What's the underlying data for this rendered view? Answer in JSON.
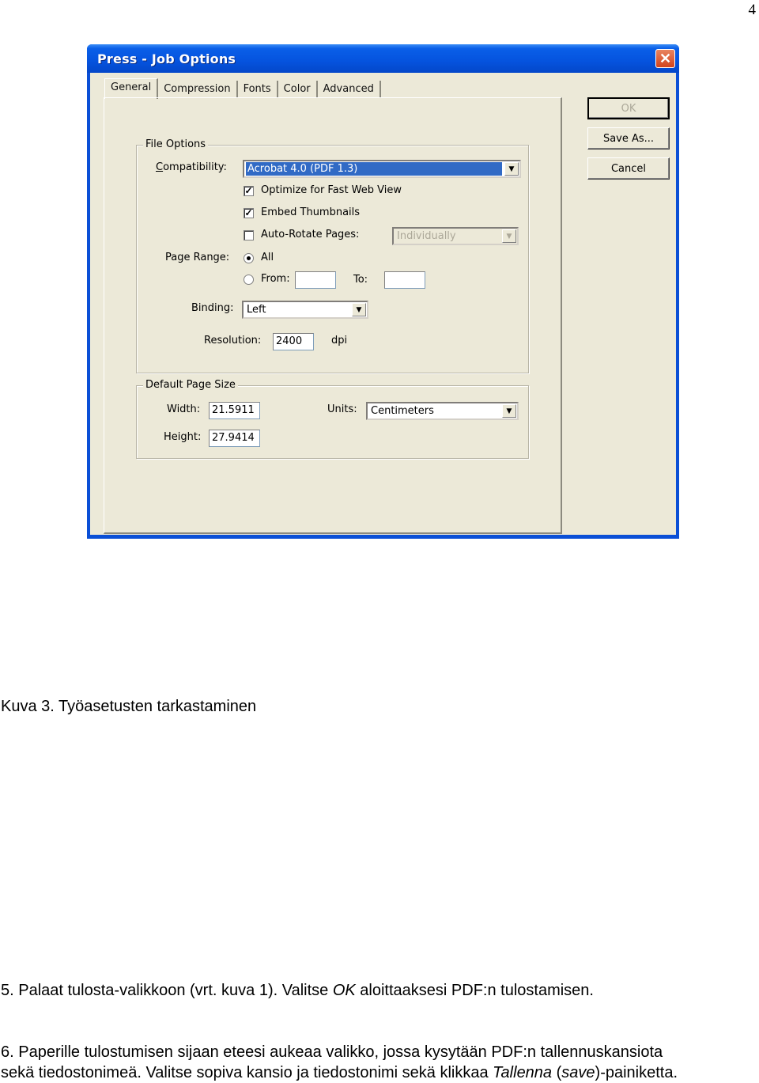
{
  "page": {
    "number": "4"
  },
  "dialog": {
    "title": "Press - Job Options",
    "close_glyph": "✕",
    "tabs": [
      {
        "label": "General",
        "active": true
      },
      {
        "label": "Compression"
      },
      {
        "label": "Fonts"
      },
      {
        "label": "Color"
      },
      {
        "label": "Advanced"
      }
    ],
    "buttons": {
      "ok": "OK",
      "save_as": "Save As...",
      "cancel": "Cancel"
    },
    "file_options": {
      "legend": "File Options",
      "compatibility_label": "Compatibility:",
      "compatibility_value": "Acrobat 4.0 (PDF 1.3)",
      "optimize_label": "Optimize for Fast Web View",
      "optimize_checked": true,
      "embed_label": "Embed Thumbnails",
      "embed_checked": true,
      "autorotate_label": "Auto-Rotate Pages:",
      "autorotate_checked": false,
      "autorotate_value": "Individually",
      "page_range_label": "Page Range:",
      "all_label": "All",
      "from_label": "From:",
      "from_value": "",
      "to_label": "To:",
      "to_value": "",
      "selected_range": "All",
      "binding_label": "Binding:",
      "binding_value": "Left",
      "resolution_label": "Resolution:",
      "resolution_value": "2400",
      "resolution_unit": "dpi"
    },
    "page_size": {
      "legend": "Default Page Size",
      "width_label": "Width:",
      "width_value": "21.5911",
      "height_label": "Height:",
      "height_value": "27.9414",
      "units_label": "Units:",
      "units_value": "Centimeters"
    }
  },
  "caption": "Kuva 3. Työasetusten tarkastaminen",
  "step5": {
    "prefix": "5.  Palaat tulosta-valikkoon (vrt. kuva 1).  Valitse ",
    "em": "OK",
    "suffix": " aloittaaksesi PDF:n tulostamisen."
  },
  "step6": {
    "line1": "6. Paperille tulostumisen sijaan eteesi aukeaa valikko, jossa kysytään PDF:n tallennuskansiota",
    "line2_prefix": "sekä tiedostonimeä. Valitse sopiva kansio ja tiedostonimi sekä klikkaa ",
    "em1": "Tallenna",
    "mid": " (",
    "em2": "save",
    "line2_suffix": ")-painiketta."
  }
}
